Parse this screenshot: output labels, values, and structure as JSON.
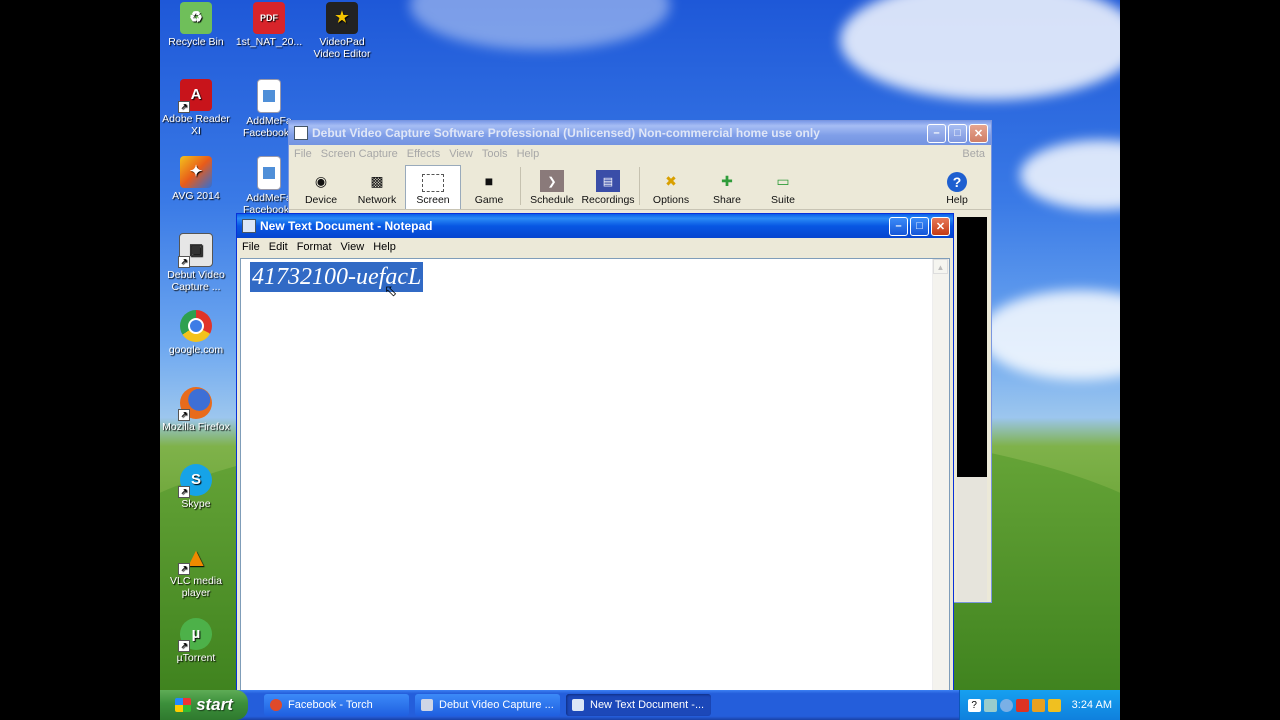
{
  "desktop": {
    "icons": [
      {
        "label": "Recycle Bin",
        "icon": "recycle-bin-icon",
        "color": "#6fbf5a"
      },
      {
        "label": "1st_NAT_20...",
        "icon": "pdf-file-icon",
        "color": "#d8242a"
      },
      {
        "label": "VideoPad Video Editor",
        "icon": "videopad-icon",
        "color": "#222222"
      },
      {
        "label": "Adobe Reader XI",
        "icon": "adobe-reader-icon",
        "color": "#c8141b"
      },
      {
        "label": "AddMeFa Facebook I",
        "icon": "text-file-icon",
        "color": "#4f8fd8"
      },
      {
        "label": "AVG 2014",
        "icon": "avg-icon",
        "color": "#e85b1a"
      },
      {
        "label": "AddMeFa Facebook I",
        "icon": "text-file-icon",
        "color": "#4f8fd8"
      },
      {
        "label": "Debut Video Capture ...",
        "icon": "debut-icon",
        "color": "#555555"
      },
      {
        "label": "google.com",
        "icon": "chrome-icon",
        "color": "#e0342a"
      },
      {
        "label": "Mozilla Firefox",
        "icon": "firefox-icon",
        "color": "#e86b1c"
      },
      {
        "label": "Skype",
        "icon": "skype-icon",
        "color": "#16a3e8"
      },
      {
        "label": "VLC media player",
        "icon": "vlc-icon",
        "color": "#f08a00"
      },
      {
        "label": "µTorrent",
        "icon": "utorrent-icon",
        "color": "#4db149"
      }
    ]
  },
  "debut": {
    "title": "Debut Video Capture Software Professional (Unlicensed) Non-commercial home use only",
    "menu": [
      "File",
      "Screen Capture",
      "Effects",
      "View",
      "Tools",
      "Help"
    ],
    "beta": "Beta",
    "tools": [
      {
        "label": "Device",
        "icon": "webcam-icon"
      },
      {
        "label": "Network",
        "icon": "network-camera-icon"
      },
      {
        "label": "Screen",
        "icon": "screen-icon"
      },
      {
        "label": "Game",
        "icon": "gamepad-icon"
      },
      {
        "label": "Schedule",
        "icon": "schedule-icon"
      },
      {
        "label": "Recordings",
        "icon": "recordings-icon"
      },
      {
        "label": "Options",
        "icon": "options-icon"
      },
      {
        "label": "Share",
        "icon": "share-icon"
      },
      {
        "label": "Suite",
        "icon": "suite-icon"
      },
      {
        "label": "Help",
        "icon": "help-icon"
      }
    ]
  },
  "notepad": {
    "title": "New Text Document - Notepad",
    "menu": [
      "File",
      "Edit",
      "Format",
      "View",
      "Help"
    ],
    "selected_text": "41732100-uefacL"
  },
  "taskbar": {
    "start": "start",
    "tasks": [
      {
        "label": "Facebook - Torch",
        "color": "#e04a2a"
      },
      {
        "label": "Debut Video Capture ...",
        "color": "#cfd6e6"
      },
      {
        "label": "New Text Document -...",
        "color": "#dbe6f6"
      }
    ],
    "clock": "3:24 AM"
  }
}
